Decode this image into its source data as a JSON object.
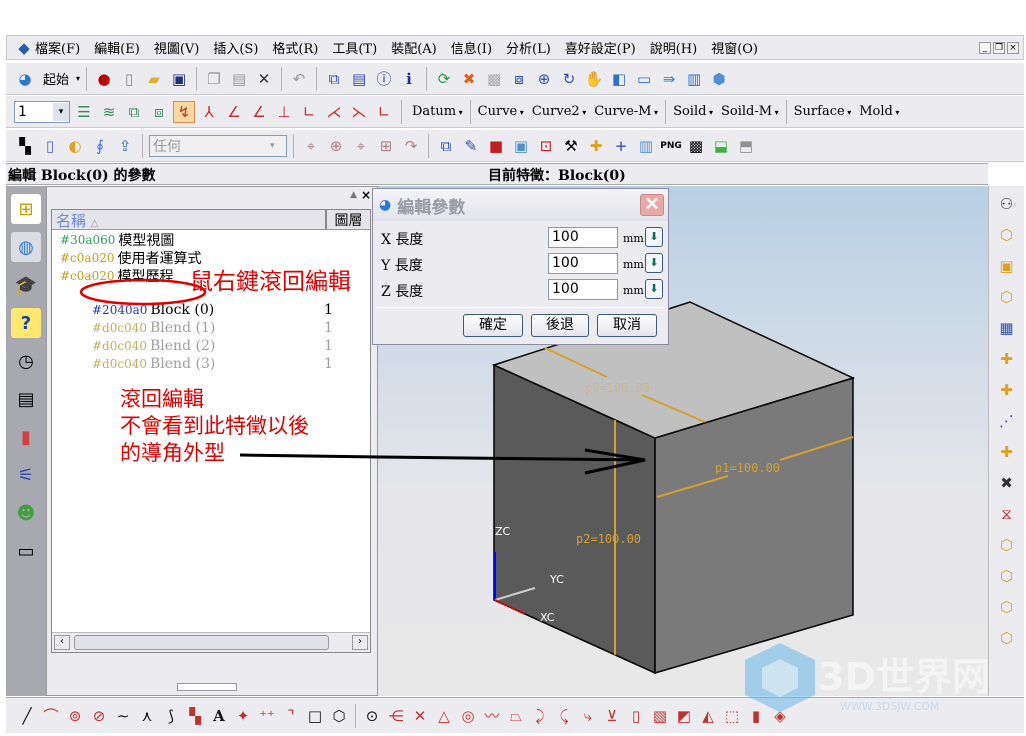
{
  "menu": [
    "檔案(F)",
    "編輯(E)",
    "視圖(V)",
    "插入(S)",
    "格式(R)",
    "工具(T)",
    "裝配(A)",
    "信息(I)",
    "分析(L)",
    "喜好設定(P)",
    "說明(H)",
    "視窗(O)"
  ],
  "toolbar1": {
    "start_label": "起始",
    "icons": [
      "record-icon",
      "new-file-icon",
      "open-folder-icon",
      "save-icon",
      "copy-icon",
      "paste-icon",
      "delete-icon",
      "undo-icon",
      "link-icon",
      "properties-icon",
      "info-icon",
      "info-box-icon",
      "refresh-icon",
      "close-x-icon",
      "grid-icon",
      "zoom-window-icon",
      "zoom-icon",
      "rotate-icon",
      "pan-icon",
      "view-icon",
      "screen-icon",
      "forward-icon",
      "display-icon",
      "shade-icon"
    ]
  },
  "toolbar2": {
    "layer_value": "1",
    "dropdowns": [
      "Datum",
      "Curve",
      "Curve2",
      "Curve-M",
      "Soild",
      "Soild-M",
      "Surface",
      "Mold"
    ]
  },
  "toolbar3": {
    "filter_value": "任何"
  },
  "status": {
    "left": "編輯 Block(0) 的參數",
    "right": "目前特徵：Block(0)"
  },
  "tree": {
    "col_name": "名稱",
    "col_layer": "圖層",
    "items": [
      {
        "label": "模型視圖",
        "layer": "",
        "enabled": true
      },
      {
        "label": "使用者運算式",
        "layer": "",
        "enabled": true
      },
      {
        "label": "模型歷程",
        "layer": "",
        "enabled": true
      },
      {
        "label": "Block (0)",
        "layer": "1",
        "enabled": true
      },
      {
        "label": "Blend (1)",
        "layer": "1",
        "enabled": false
      },
      {
        "label": "Blend (2)",
        "layer": "1",
        "enabled": false
      },
      {
        "label": "Blend (3)",
        "layer": "1",
        "enabled": false
      }
    ]
  },
  "dialog": {
    "title": "編輯參數",
    "rows": [
      {
        "label": "X 長度",
        "value": "100",
        "unit": "mm"
      },
      {
        "label": "Y 長度",
        "value": "100",
        "unit": "mm"
      },
      {
        "label": "Z 長度",
        "value": "100",
        "unit": "mm"
      }
    ],
    "ok": "確定",
    "back": "後退",
    "cancel": "取消"
  },
  "viewport": {
    "dims": [
      "p0=100.00",
      "p1=100.00",
      "p2=100.00"
    ],
    "axes": [
      "ZC",
      "YC",
      "XC"
    ],
    "dim_color": "#d4a030"
  },
  "annotations": {
    "right_click": "鼠右鍵滾回編輯",
    "note": [
      "滾回編輯",
      "不會看到此特徵以後",
      "的導角外型"
    ],
    "color": "#e00000"
  },
  "watermark": {
    "text": "3D世界网",
    "url_text": "WWW.3DSJW.COM"
  }
}
